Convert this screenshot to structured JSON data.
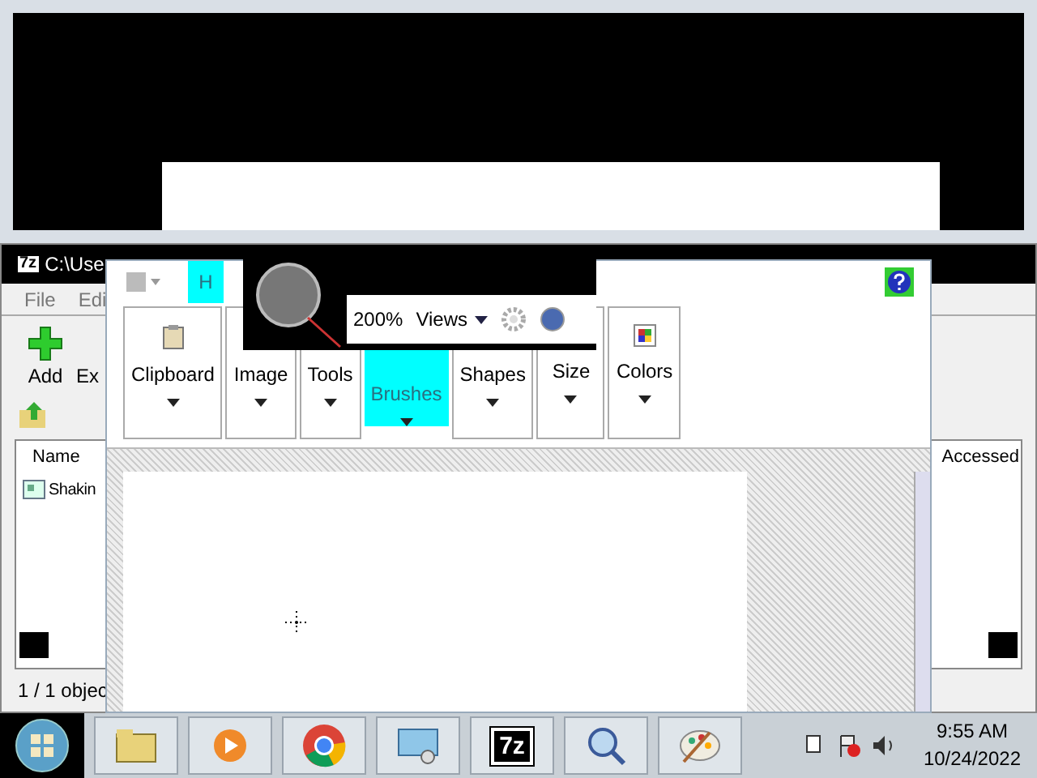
{
  "sevenzip": {
    "logo": "7z",
    "title": "C:\\Use",
    "menu": [
      "File",
      "Edi"
    ],
    "toolbar": [
      "Add",
      "Ex"
    ],
    "columns": [
      "Name",
      "Accessed"
    ],
    "rows": [
      "Shakin"
    ],
    "status": "1 / 1 objec"
  },
  "paint": {
    "tab": {
      "label": "H",
      "selected": true
    },
    "groups": [
      {
        "label": "Clipboard",
        "selected": false
      },
      {
        "label": "Image",
        "selected": false
      },
      {
        "label": "Tools",
        "selected": false
      },
      {
        "label": "Brushes",
        "selected": true
      },
      {
        "label": "Shapes",
        "selected": false
      },
      {
        "label": "Size",
        "selected": false
      },
      {
        "label": "Colors",
        "selected": false
      }
    ]
  },
  "magnifier": {
    "zoom": "200%",
    "views": "Views"
  },
  "taskbar": {
    "apps": [
      {
        "kind": "folder"
      },
      {
        "kind": "media"
      },
      {
        "kind": "browser"
      },
      {
        "kind": "network"
      },
      {
        "kind": "archive",
        "label": "7z"
      },
      {
        "kind": "search"
      },
      {
        "kind": "paint"
      }
    ],
    "time": "9:55 AM",
    "date": "10/24/2022"
  }
}
